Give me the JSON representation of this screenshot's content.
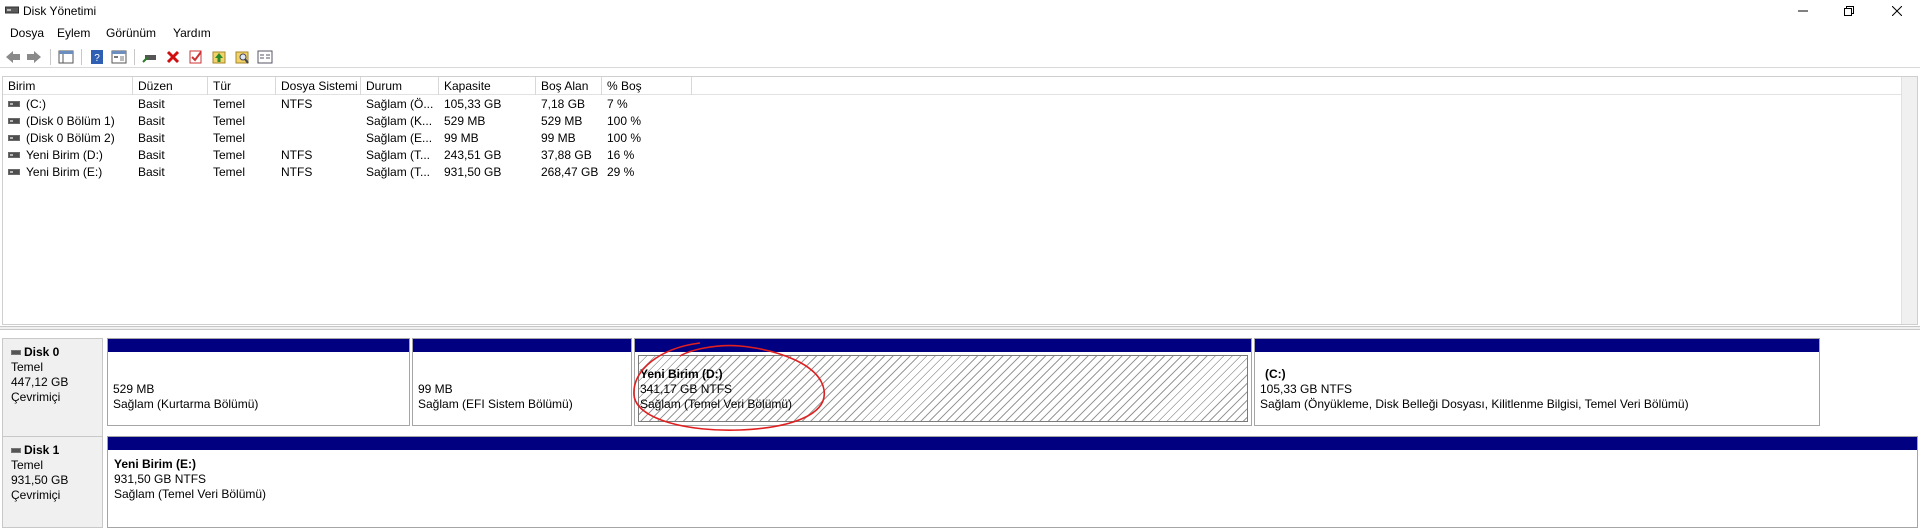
{
  "window": {
    "title": "Disk Yönetimi"
  },
  "menu": [
    "Dosya",
    "Eylem",
    "Görünüm",
    "Yardım"
  ],
  "toolbar_icons": [
    "back-arrow-icon",
    "forward-arrow-icon",
    "console-tree-icon",
    "help-icon",
    "properties-icon",
    "connect-icon",
    "delete-icon",
    "check-icon",
    "export-icon",
    "find-icon",
    "details-icon"
  ],
  "volumes": {
    "columns": [
      "Birim",
      "Düzen",
      "Tür",
      "Dosya Sistemi",
      "Durum",
      "Kapasite",
      "Boş Alan",
      "% Boş"
    ],
    "rows": [
      [
        "(C:)",
        "Basit",
        "Temel",
        "NTFS",
        "Sağlam (Ö...",
        "105,33 GB",
        "7,18 GB",
        "7 %"
      ],
      [
        "(Disk 0 Bölüm 1)",
        "Basit",
        "Temel",
        "",
        "Sağlam (K...",
        "529 MB",
        "529 MB",
        "100 %"
      ],
      [
        "(Disk 0 Bölüm 2)",
        "Basit",
        "Temel",
        "",
        "Sağlam (E...",
        "99 MB",
        "99 MB",
        "100 %"
      ],
      [
        "Yeni Birim (D:)",
        "Basit",
        "Temel",
        "NTFS",
        "Sağlam (T...",
        "243,51 GB",
        "37,88 GB",
        "16 %"
      ],
      [
        "Yeni Birim (E:)",
        "Basit",
        "Temel",
        "NTFS",
        "Sağlam (T...",
        "931,50 GB",
        "268,47 GB",
        "29 %"
      ]
    ]
  },
  "disks": [
    {
      "name": "Disk 0",
      "type": "Temel",
      "size": "447,12 GB",
      "status": "Çevrimiçi",
      "partitions": [
        {
          "title": "",
          "line1": "529 MB",
          "line2": "Sağlam (Kurtarma Bölümü)"
        },
        {
          "title": "",
          "line1": "99 MB",
          "line2": "Sağlam (EFI Sistem Bölümü)"
        },
        {
          "title": "Yeni Birim  (D:)",
          "line1": "341,17 GB NTFS",
          "line2": "Sağlam (Temel Veri Bölümü)"
        },
        {
          "title": "(C:)",
          "line1": "105,33 GB NTFS",
          "line2": "Sağlam (Önyükleme, Disk Belleği Dosyası, Kilitlenme Bilgisi, Temel Veri Bölümü)"
        }
      ]
    },
    {
      "name": "Disk 1",
      "type": "Temel",
      "size": "931,50 GB",
      "status": "Çevrimiçi",
      "partitions": [
        {
          "title": "Yeni Birim  (E:)",
          "line1": "931,50 GB NTFS",
          "line2": "Sağlam (Temel Veri Bölümü)"
        }
      ]
    }
  ],
  "colors": {
    "partition_band": "#000080",
    "annotation": "#e02020"
  }
}
